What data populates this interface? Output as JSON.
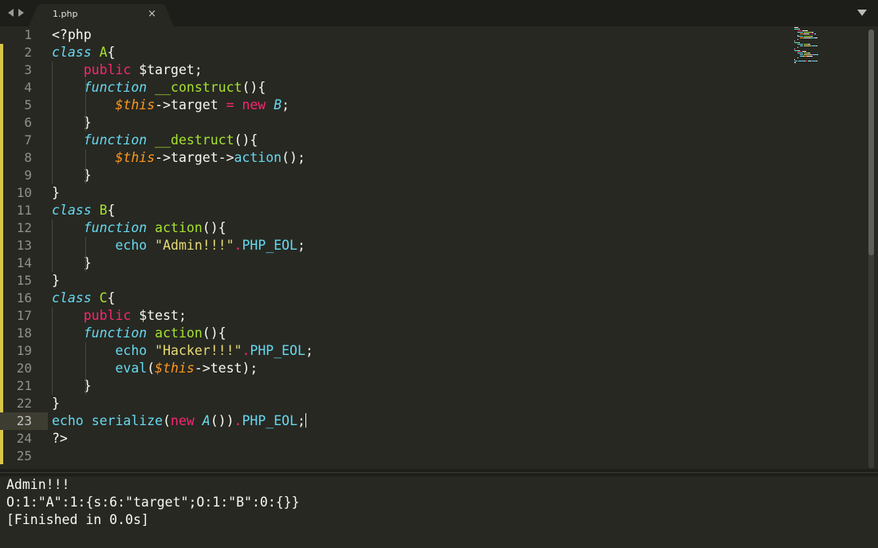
{
  "tabbar": {
    "tab_title": "1.php",
    "close_glyph": "×"
  },
  "editor": {
    "line_numbers": [
      "1",
      "2",
      "3",
      "4",
      "5",
      "6",
      "7",
      "8",
      "9",
      "10",
      "11",
      "12",
      "13",
      "14",
      "15",
      "16",
      "17",
      "18",
      "19",
      "20",
      "21",
      "22",
      "23",
      "24",
      "25"
    ],
    "current_line": 23,
    "lines": [
      [
        [
          "plain",
          "<?php"
        ]
      ],
      [
        [
          "k-class",
          "class"
        ],
        [
          "plain",
          " "
        ],
        [
          "cls-name",
          "A"
        ],
        [
          "plain",
          "{"
        ]
      ],
      [
        [
          "plain",
          "    "
        ],
        [
          "kw",
          "public"
        ],
        [
          "plain",
          " $target;"
        ]
      ],
      [
        [
          "plain",
          "    "
        ],
        [
          "k-fn",
          "function"
        ],
        [
          "plain",
          " "
        ],
        [
          "fname",
          "__construct"
        ],
        [
          "plain",
          "(){"
        ]
      ],
      [
        [
          "plain",
          "        "
        ],
        [
          "this",
          "$this"
        ],
        [
          "plain",
          "->target "
        ],
        [
          "kw",
          "="
        ],
        [
          "plain",
          " "
        ],
        [
          "kw",
          "new"
        ],
        [
          "plain",
          " "
        ],
        [
          "cls-ref",
          "B"
        ],
        [
          "plain",
          ";"
        ]
      ],
      [
        [
          "plain",
          "    }"
        ]
      ],
      [
        [
          "plain",
          "    "
        ],
        [
          "k-fn",
          "function"
        ],
        [
          "plain",
          " "
        ],
        [
          "fname",
          "__destruct"
        ],
        [
          "plain",
          "(){"
        ]
      ],
      [
        [
          "plain",
          "        "
        ],
        [
          "this",
          "$this"
        ],
        [
          "plain",
          "->target->"
        ],
        [
          "fn-call",
          "action"
        ],
        [
          "plain",
          "();"
        ]
      ],
      [
        [
          "plain",
          "    }"
        ]
      ],
      [
        [
          "plain",
          "}"
        ]
      ],
      [
        [
          "k-class",
          "class"
        ],
        [
          "plain",
          " "
        ],
        [
          "cls-name",
          "B"
        ],
        [
          "plain",
          "{"
        ]
      ],
      [
        [
          "plain",
          "    "
        ],
        [
          "k-fn",
          "function"
        ],
        [
          "plain",
          " "
        ],
        [
          "fname",
          "action"
        ],
        [
          "plain",
          "(){"
        ]
      ],
      [
        [
          "plain",
          "        "
        ],
        [
          "fn-call",
          "echo"
        ],
        [
          "plain",
          " "
        ],
        [
          "str",
          "\"Admin!!!\""
        ],
        [
          "kw",
          "."
        ],
        [
          "const",
          "PHP_EOL"
        ],
        [
          "plain",
          ";"
        ]
      ],
      [
        [
          "plain",
          "    }"
        ]
      ],
      [
        [
          "plain",
          "}"
        ]
      ],
      [
        [
          "k-class",
          "class"
        ],
        [
          "plain",
          " "
        ],
        [
          "cls-name",
          "C"
        ],
        [
          "plain",
          "{"
        ]
      ],
      [
        [
          "plain",
          "    "
        ],
        [
          "kw",
          "public"
        ],
        [
          "plain",
          " $test;"
        ]
      ],
      [
        [
          "plain",
          "    "
        ],
        [
          "k-fn",
          "function"
        ],
        [
          "plain",
          " "
        ],
        [
          "fname",
          "action"
        ],
        [
          "plain",
          "(){"
        ]
      ],
      [
        [
          "plain",
          "        "
        ],
        [
          "fn-call",
          "echo"
        ],
        [
          "plain",
          " "
        ],
        [
          "str",
          "\"Hacker!!!\""
        ],
        [
          "kw",
          "."
        ],
        [
          "const",
          "PHP_EOL"
        ],
        [
          "plain",
          ";"
        ]
      ],
      [
        [
          "plain",
          "        "
        ],
        [
          "fn-call",
          "eval"
        ],
        [
          "plain",
          "("
        ],
        [
          "this",
          "$this"
        ],
        [
          "plain",
          "->test);"
        ]
      ],
      [
        [
          "plain",
          "    }"
        ]
      ],
      [
        [
          "plain",
          "}"
        ]
      ],
      [
        [
          "fn-call",
          "echo"
        ],
        [
          "plain",
          " "
        ],
        [
          "fn-call",
          "serialize"
        ],
        [
          "plain",
          "("
        ],
        [
          "kw",
          "new"
        ],
        [
          "plain",
          " "
        ],
        [
          "cls-ref",
          "A"
        ],
        [
          "plain",
          "())"
        ],
        [
          "kw",
          "."
        ],
        [
          "const",
          "PHP_EOL"
        ],
        [
          "plain",
          ";"
        ]
      ],
      [
        [
          "plain",
          "?>"
        ]
      ],
      []
    ]
  },
  "output": {
    "lines": [
      "Admin!!!",
      "O:1:\"A\":1:{s:6:\"target\";O:1:\"B\":0:{}}",
      "[Finished in 0.0s]"
    ]
  },
  "colors": {
    "background": "#272822",
    "keyword": "#f92672",
    "storage": "#66d9ef",
    "function_name": "#a6e22e",
    "string": "#e6db74",
    "variable": "#fd971f",
    "gutter_mark": "#d9c547"
  },
  "icons": {
    "nav": [
      "arrow-left-icon",
      "arrow-right-icon"
    ],
    "panel": "panel-dropdown-icon"
  }
}
